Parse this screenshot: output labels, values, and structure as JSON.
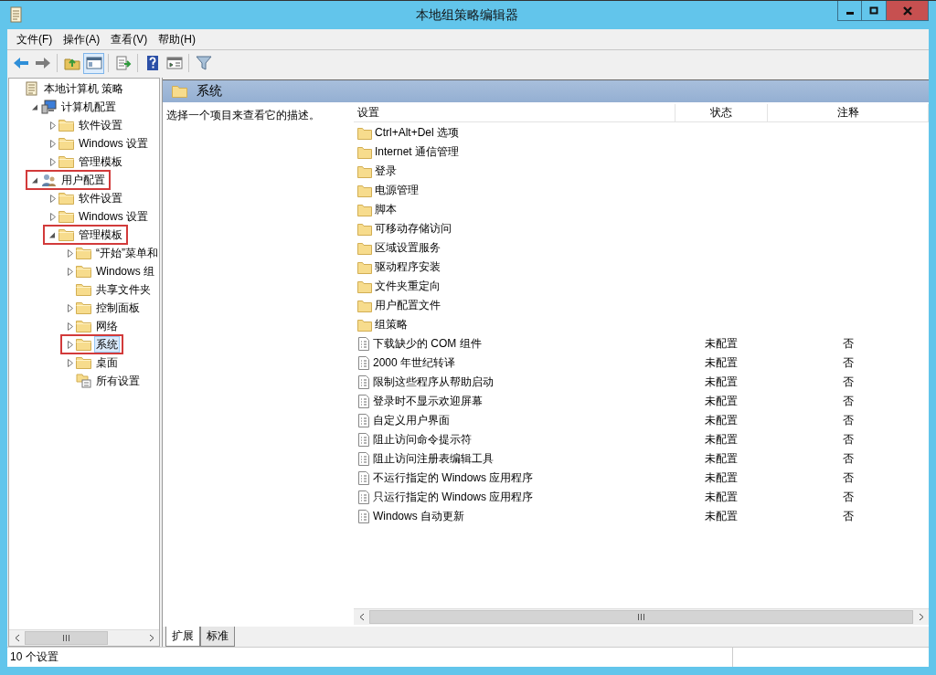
{
  "window": {
    "title": "本地组策略编辑器"
  },
  "menu": [
    "文件(F)",
    "操作(A)",
    "查看(V)",
    "帮助(H)"
  ],
  "toolbar": [
    {
      "kind": "back",
      "selected": false
    },
    {
      "kind": "forward",
      "selected": false
    },
    {
      "kind": "up",
      "selected": false
    },
    {
      "kind": "tree",
      "selected": true
    },
    {
      "kind": "export",
      "selected": false
    },
    {
      "kind": "help",
      "selected": false
    },
    {
      "kind": "view",
      "selected": false
    },
    {
      "kind": "filter",
      "selected": false
    }
  ],
  "tree": [
    {
      "label": "本地计算机 策略",
      "kind": "policy",
      "selected": false,
      "marked": false,
      "children": [
        {
          "label": "计算机配置",
          "kind": "computer",
          "expanded": true,
          "selected": false,
          "marked": false,
          "children": [
            {
              "label": "软件设置",
              "kind": "folder",
              "expanded": false,
              "selected": false,
              "marked": false
            },
            {
              "label": "Windows 设置",
              "kind": "folder",
              "expanded": false,
              "selected": false,
              "marked": false
            },
            {
              "label": "管理模板",
              "kind": "folder",
              "expanded": false,
              "selected": false,
              "marked": false
            }
          ]
        },
        {
          "label": "用户配置",
          "kind": "user",
          "expanded": true,
          "selected": false,
          "marked": true,
          "children": [
            {
              "label": "软件设置",
              "kind": "folder",
              "expanded": false,
              "selected": false,
              "marked": false
            },
            {
              "label": "Windows 设置",
              "kind": "folder",
              "expanded": false,
              "selected": false,
              "marked": false
            },
            {
              "label": "管理模板",
              "kind": "folder",
              "expanded": true,
              "selected": false,
              "marked": true,
              "children": [
                {
                  "label": "“开始”菜单和",
                  "kind": "folder",
                  "expanded": false,
                  "selected": false,
                  "marked": false
                },
                {
                  "label": "Windows 组",
                  "kind": "folder",
                  "expanded": false,
                  "selected": false,
                  "marked": false
                },
                {
                  "label": "共享文件夹",
                  "kind": "folder",
                  "selected": false,
                  "marked": false
                },
                {
                  "label": "控制面板",
                  "kind": "folder",
                  "expanded": false,
                  "selected": false,
                  "marked": false
                },
                {
                  "label": "网络",
                  "kind": "folder",
                  "expanded": false,
                  "selected": false,
                  "marked": false
                },
                {
                  "label": "系统",
                  "kind": "folder",
                  "expanded": false,
                  "selected": true,
                  "marked": true
                },
                {
                  "label": "桌面",
                  "kind": "folder",
                  "expanded": false,
                  "selected": false,
                  "marked": false
                },
                {
                  "label": "所有设置",
                  "kind": "settings",
                  "selected": false,
                  "marked": false
                }
              ]
            }
          ]
        }
      ]
    }
  ],
  "pane": {
    "title": "系统",
    "description": "选择一个项目来查看它的描述。",
    "columns": [
      "设置",
      "状态",
      "注释"
    ],
    "rows": [
      {
        "kind": "folder",
        "name": "Ctrl+Alt+Del 选项"
      },
      {
        "kind": "folder",
        "name": "Internet 通信管理"
      },
      {
        "kind": "folder",
        "name": "登录"
      },
      {
        "kind": "folder",
        "name": "电源管理"
      },
      {
        "kind": "folder",
        "name": "脚本"
      },
      {
        "kind": "folder",
        "name": "可移动存储访问"
      },
      {
        "kind": "folder",
        "name": "区域设置服务"
      },
      {
        "kind": "folder",
        "name": "驱动程序安装"
      },
      {
        "kind": "folder",
        "name": "文件夹重定向"
      },
      {
        "kind": "folder",
        "name": "用户配置文件"
      },
      {
        "kind": "folder",
        "name": "组策略"
      },
      {
        "kind": "setting",
        "name": "下载缺少的 COM 组件",
        "state": "未配置",
        "note": "否"
      },
      {
        "kind": "setting",
        "name": "2000 年世纪转译",
        "state": "未配置",
        "note": "否"
      },
      {
        "kind": "setting",
        "name": "限制这些程序从帮助启动",
        "state": "未配置",
        "note": "否"
      },
      {
        "kind": "setting",
        "name": "登录时不显示欢迎屏幕",
        "state": "未配置",
        "note": "否"
      },
      {
        "kind": "setting",
        "name": "自定义用户界面",
        "state": "未配置",
        "note": "否"
      },
      {
        "kind": "setting",
        "name": "阻止访问命令提示符",
        "state": "未配置",
        "note": "否"
      },
      {
        "kind": "setting",
        "name": "阻止访问注册表编辑工具",
        "state": "未配置",
        "note": "否"
      },
      {
        "kind": "setting",
        "name": "不运行指定的 Windows 应用程序",
        "state": "未配置",
        "note": "否"
      },
      {
        "kind": "setting",
        "name": "只运行指定的 Windows 应用程序",
        "state": "未配置",
        "note": "否"
      },
      {
        "kind": "setting",
        "name": "Windows 自动更新",
        "state": "未配置",
        "note": "否"
      }
    ],
    "tabs": [
      {
        "label": "扩展",
        "selected": true
      },
      {
        "label": "标准",
        "selected": false
      }
    ]
  },
  "status_bar": "10 个设置"
}
